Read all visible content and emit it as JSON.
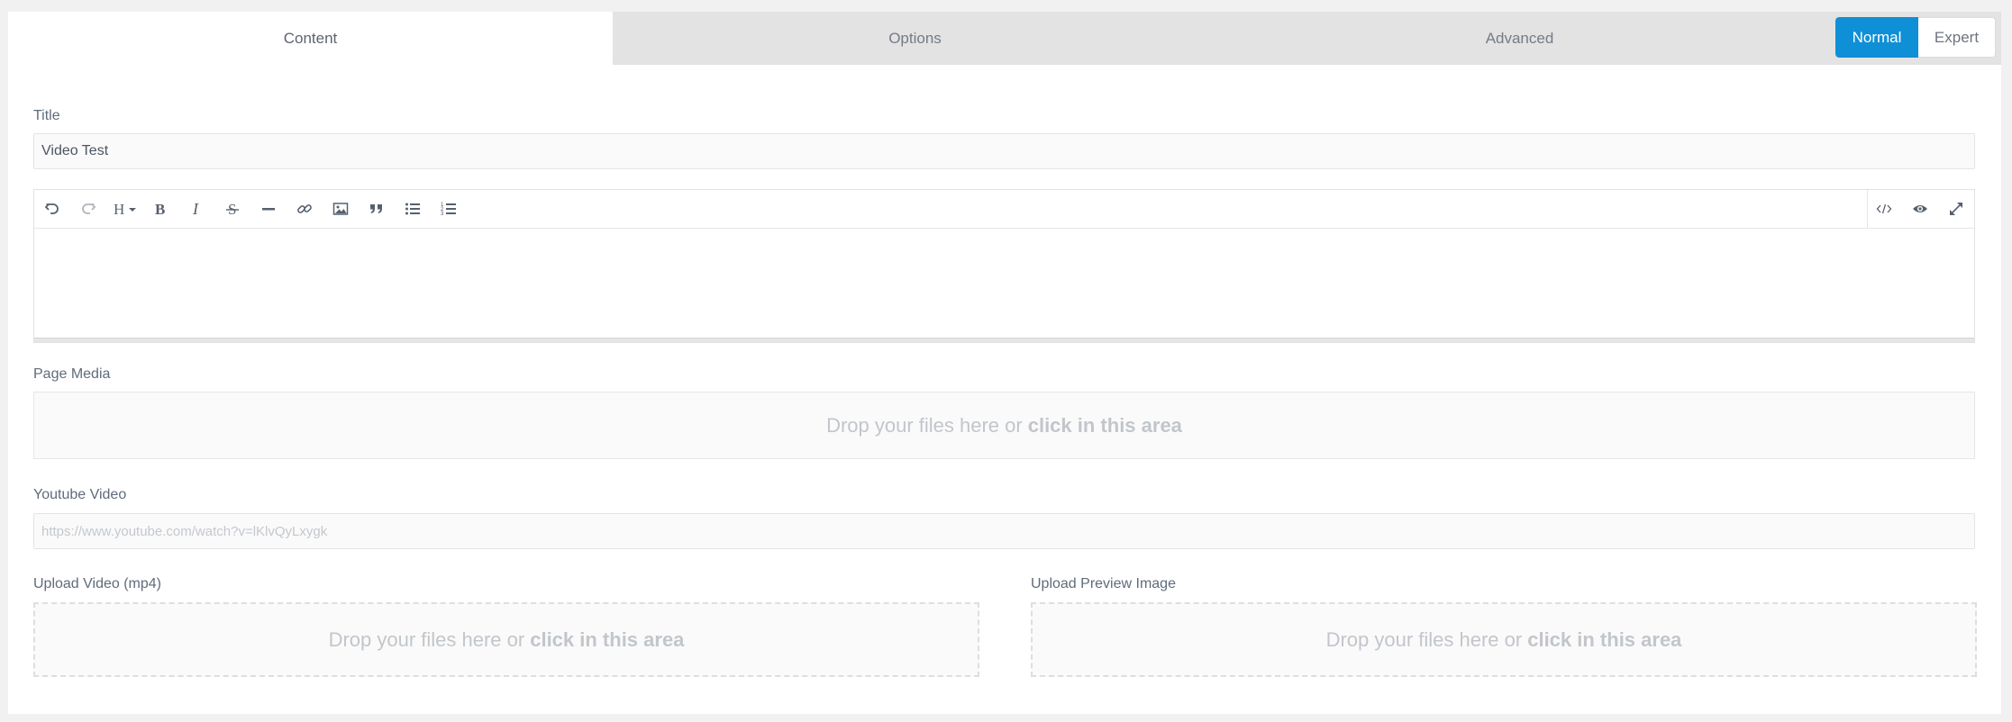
{
  "tabs": [
    {
      "label": "Content",
      "active": true
    },
    {
      "label": "Options",
      "active": false
    },
    {
      "label": "Advanced",
      "active": false
    }
  ],
  "mode": {
    "normal_label": "Normal",
    "expert_label": "Expert",
    "selected": "Normal"
  },
  "colors": {
    "accent": "#0f8fd6",
    "tab_bg": "#e3e3e3",
    "panel_bg": "#ffffff",
    "page_bg": "#f1f1f1"
  },
  "title_field": {
    "label": "Title",
    "value": "Video Test"
  },
  "editor": {
    "toolbar_left": [
      "undo-icon",
      "redo-icon",
      "heading-icon",
      "bold-icon",
      "italic-icon",
      "strikethrough-icon",
      "horizontal-rule-icon",
      "link-icon",
      "image-icon",
      "quote-icon",
      "bullet-list-icon",
      "numbered-list-icon"
    ],
    "toolbar_right": [
      "code-icon",
      "preview-icon",
      "fullscreen-icon"
    ],
    "content": ""
  },
  "page_media": {
    "label": "Page Media",
    "drop_text": "Drop your files here or",
    "drop_link": "click in this area"
  },
  "youtube": {
    "label": "Youtube Video",
    "placeholder": "https://www.youtube.com/watch?v=lKlvQyLxygk",
    "value": ""
  },
  "upload_video": {
    "label": "Upload Video (mp4)",
    "drop_text": "Drop your files here or",
    "drop_link": "click in this area"
  },
  "upload_preview": {
    "label": "Upload Preview Image",
    "drop_text": "Drop your files here or",
    "drop_link": "click in this area"
  }
}
